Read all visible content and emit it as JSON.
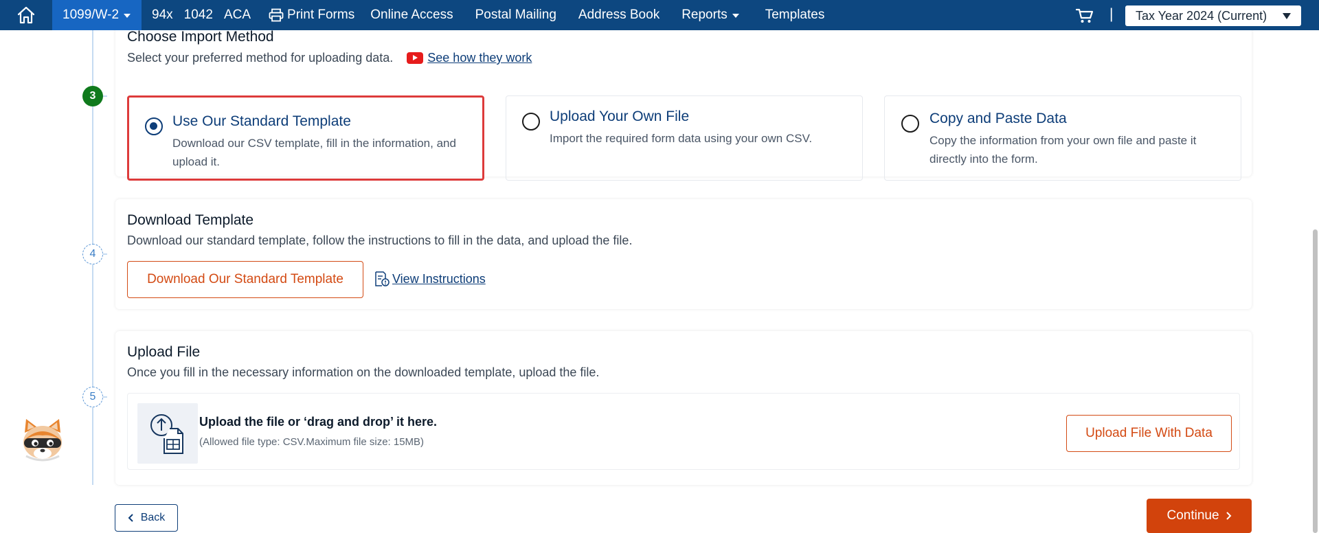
{
  "nav": {
    "items": [
      {
        "label": "1099/W-2",
        "dropdown": true,
        "active": true
      },
      {
        "label": "94x"
      },
      {
        "label": "1042"
      },
      {
        "label": "ACA"
      },
      {
        "label": "Print Forms",
        "icon": "printer-icon"
      },
      {
        "label": "Online Access"
      },
      {
        "label": "Postal Mailing"
      },
      {
        "label": "Address Book"
      },
      {
        "label": "Reports",
        "dropdown": true
      },
      {
        "label": "Templates"
      }
    ],
    "separator": "|",
    "tax_year": "Tax Year 2024 (Current)"
  },
  "steps": {
    "step3": {
      "number": "3",
      "title": "Choose Import Method",
      "subtitle": "Select your preferred method for uploading data.",
      "video_link": "See how they work",
      "methods": [
        {
          "title": "Use Our Standard Template",
          "desc_line1": "Download our CSV template, fill in the information, and",
          "desc_line2": "upload it.",
          "selected": true
        },
        {
          "title": "Upload Your Own File",
          "desc_line1": "Import the required form data using your own CSV.",
          "desc_line2": ""
        },
        {
          "title": "Copy and Paste Data",
          "desc_line1": "Copy the information from your own file and paste it",
          "desc_line2": "directly into the form."
        }
      ]
    },
    "step4": {
      "number": "4",
      "title": "Download Template",
      "subtitle": "Download our standard template, follow the instructions to fill in the data, and upload the file.",
      "download_button": "Download Our Standard Template",
      "instructions_link": "View Instructions"
    },
    "step5": {
      "number": "5",
      "title": "Upload File",
      "subtitle": "Once you fill in the necessary information on the downloaded template, upload the file.",
      "drop_title": "Upload the file or ‘drag and drop’ it here.",
      "drop_hint": "(Allowed file type: CSV.Maximum file size: 15MB)",
      "upload_button": "Upload File With Data"
    }
  },
  "footer": {
    "back_label": "Back",
    "continue_label": "Continue"
  },
  "colors": {
    "nav_bg": "#0d4780",
    "nav_active": "#1766c2",
    "accent_orange": "#d2430c",
    "primary_navy": "#0d3d78",
    "selection_border": "#dd3b3b",
    "step_done": "#0f7a1c"
  }
}
